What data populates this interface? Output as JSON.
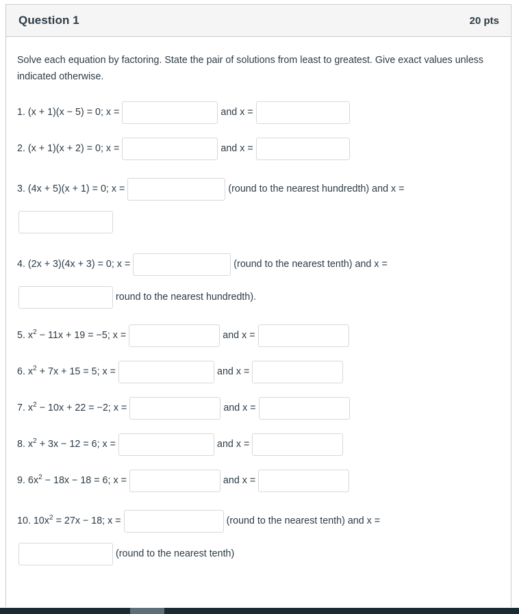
{
  "header": {
    "title": "Question 1",
    "points": "20 pts"
  },
  "instructions": "Solve each equation by factoring. State the pair of solutions from least to greatest. Give exact values unless indicated otherwise.",
  "connector": {
    "and_x": "and x =",
    "x_equals": "x ="
  },
  "items": [
    {
      "number": "1.",
      "prefix": "1. (x + 1)(x − 5) = 0; x =",
      "middle": "and x =",
      "suffix": "",
      "second_line": "",
      "blank1_value": "",
      "blank2_value": "",
      "wrapped": false
    },
    {
      "number": "2.",
      "prefix": "2. (x + 1)(x + 2) = 0; x =",
      "middle": "and x =",
      "suffix": "",
      "second_line": "",
      "blank1_value": "",
      "blank2_value": "",
      "wrapped": false
    },
    {
      "number": "3.",
      "prefix": "3. (4x + 5)(x + 1) = 0; x =",
      "middle": "(round to the nearest hundredth) and x =",
      "suffix": "",
      "second_line": "",
      "blank1_value": "",
      "blank2_value": "",
      "wrapped": true
    },
    {
      "number": "4.",
      "prefix": "4. (2x + 3)(4x + 3) = 0; x =",
      "middle": "(round to the nearest tenth) and x =",
      "suffix": "",
      "second_line": "round to the nearest hundredth).",
      "blank1_value": "",
      "blank2_value": "",
      "wrapped": true
    },
    {
      "number": "5.",
      "prefix_html": "5. x<sup>2</sup> − 11x + 19 = −5; x =",
      "middle": "and x =",
      "suffix": "",
      "second_line": "",
      "blank1_value": "",
      "blank2_value": "",
      "wrapped": false
    },
    {
      "number": "6.",
      "prefix_html": "6. x<sup>2</sup> + 7x + 15 = 5; x =",
      "middle": "and x =",
      "suffix": "",
      "second_line": "",
      "blank1_value": "",
      "blank2_value": "",
      "wrapped": false
    },
    {
      "number": "7.",
      "prefix_html": "7. x<sup>2</sup> − 10x + 22 = −2; x =",
      "middle": "and x =",
      "suffix": "",
      "second_line": "",
      "blank1_value": "",
      "blank2_value": "",
      "wrapped": false
    },
    {
      "number": "8.",
      "prefix_html": "8. x<sup>2</sup> + 3x − 12 = 6; x =",
      "middle": "and x =",
      "suffix": "",
      "second_line": "",
      "blank1_value": "",
      "blank2_value": "",
      "wrapped": false
    },
    {
      "number": "9.",
      "prefix_html": "9. 6x<sup>2</sup> − 18x − 18 = 6; x =",
      "middle": "and x =",
      "suffix": "",
      "second_line": "",
      "blank1_value": "",
      "blank2_value": "",
      "wrapped": false
    },
    {
      "number": "10.",
      "prefix_html": "10. 10x<sup>2</sup> = 27x − 18; x =",
      "middle": "(round to the nearest tenth) and x =",
      "suffix": "",
      "second_line": "(round to the nearest tenth)",
      "blank1_value": "",
      "blank2_value": "",
      "wrapped": true
    }
  ],
  "item_labels": {
    "q1_prefix": "1. (x + 1)(x − 5) = 0; x =",
    "q2_prefix": "2. (x + 1)(x + 2) = 0; x =",
    "q3_prefix": "3. (4x + 5)(x + 1) = 0; x =",
    "q4_prefix": "4. (2x + 3)(4x + 3) = 0; x =",
    "q3_mid": "(round to the nearest hundredth) and x =",
    "q4_mid": "(round to the nearest tenth) and x =",
    "q4_tail": "round to the nearest hundredth).",
    "q10_mid": "(round to the nearest tenth) and x =",
    "q10_tail": "(round to the nearest tenth)"
  },
  "colors": {
    "text": "#2d3b45",
    "header_bg": "#f5f5f5",
    "card_border": "#c7cdd1",
    "input_border": "#d8d8d8",
    "scrollbar_track": "#1b2b34",
    "scrollbar_thumb": "#5d7079"
  },
  "scrollbar": {
    "orientation": "horizontal",
    "position_label": "25%"
  }
}
